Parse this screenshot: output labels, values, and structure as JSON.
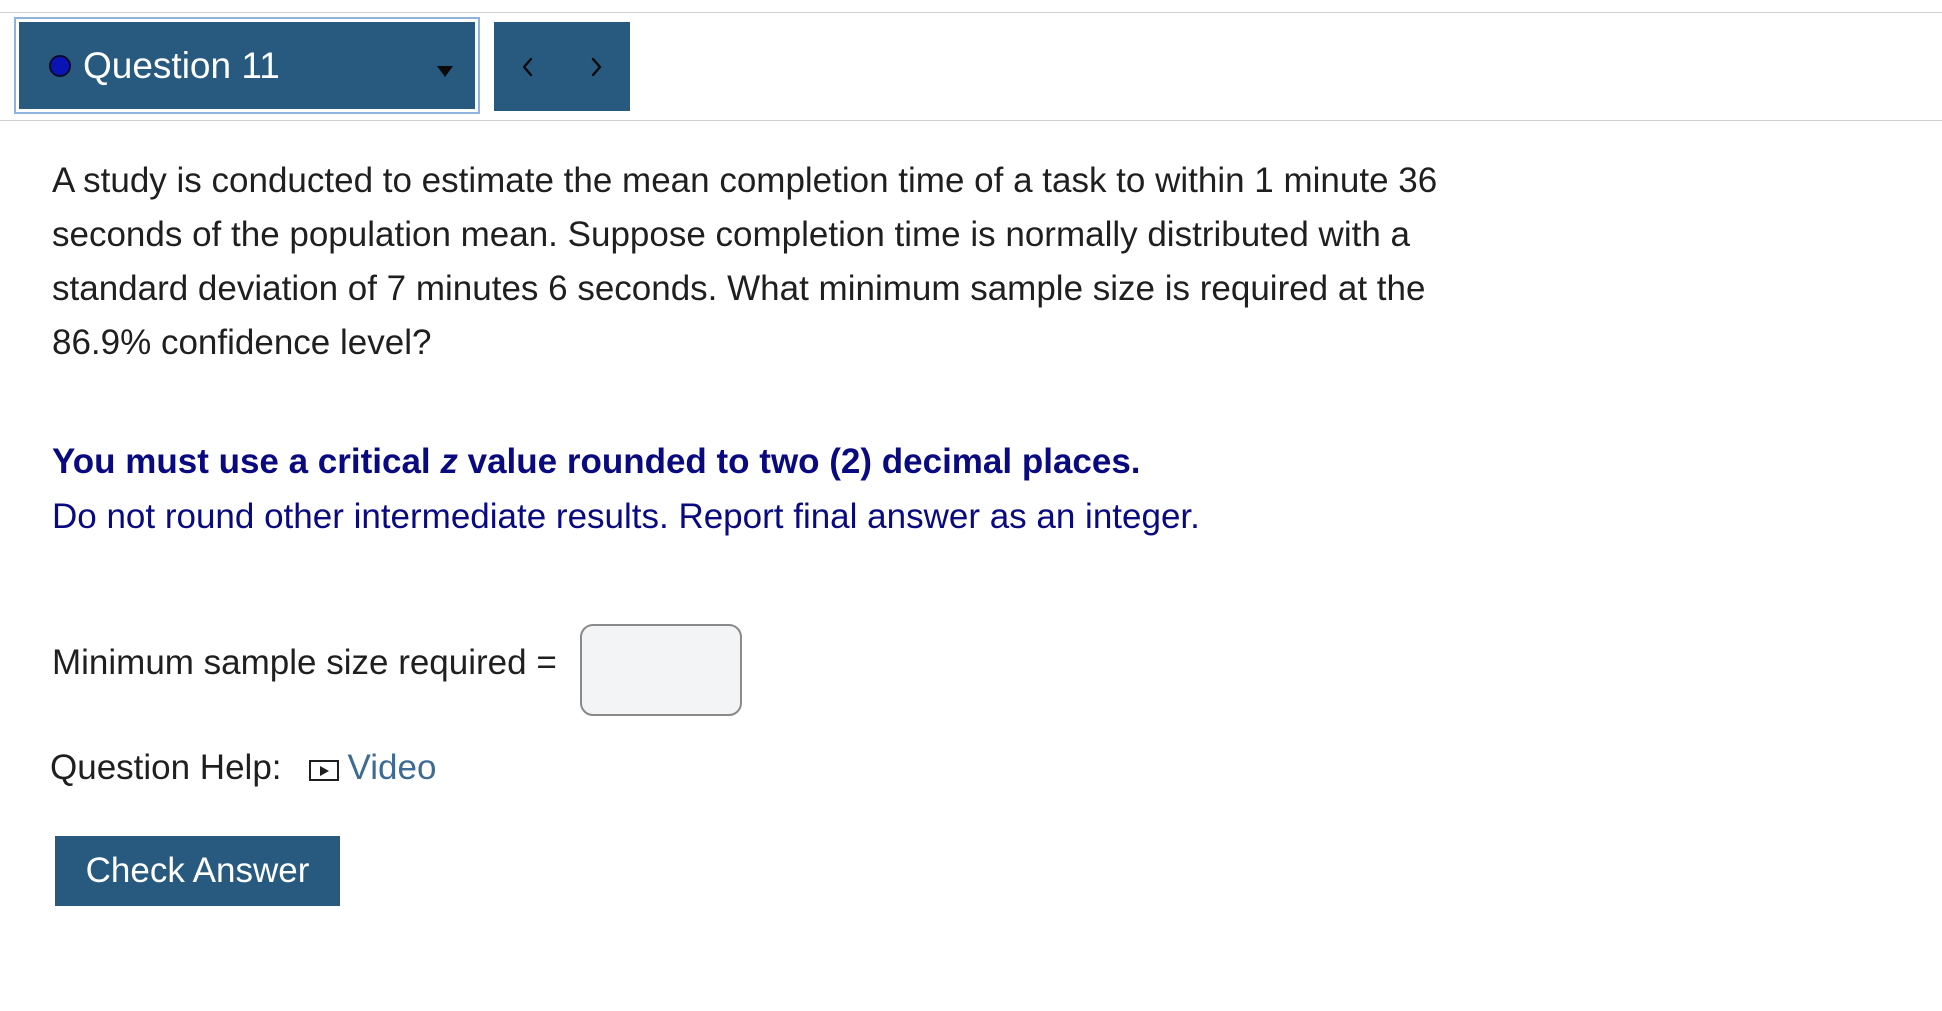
{
  "nav": {
    "question_label": "Question 11",
    "status_color": "#0a14b4",
    "prev_icon": "chevron-left-icon",
    "next_icon": "chevron-right-icon",
    "dropdown_icon": "caret-down-icon"
  },
  "problem": {
    "text": "A study is conducted to estimate the mean completion time of a task to within 1 minute 36 seconds of the population mean. Suppose completion time is normally distributed with a standard deviation of 7 minutes 6 seconds. What minimum sample size is required at the 86.9% confidence level?"
  },
  "instructions": {
    "bold_prefix": "You must use a critical ",
    "bold_italic": "z",
    "bold_suffix": " value rounded to two (2) decimal places.",
    "normal": "Do not round other intermediate results. Report final answer as an integer."
  },
  "answer": {
    "label": "Minimum sample size required =",
    "value": "",
    "placeholder": ""
  },
  "help": {
    "label": "Question Help:",
    "video_icon": "video-icon",
    "video_link": "Video"
  },
  "actions": {
    "check_label": "Check Answer"
  },
  "colors": {
    "primary": "#285a80",
    "instruction": "#0a0a80",
    "link": "#3e6b93"
  }
}
